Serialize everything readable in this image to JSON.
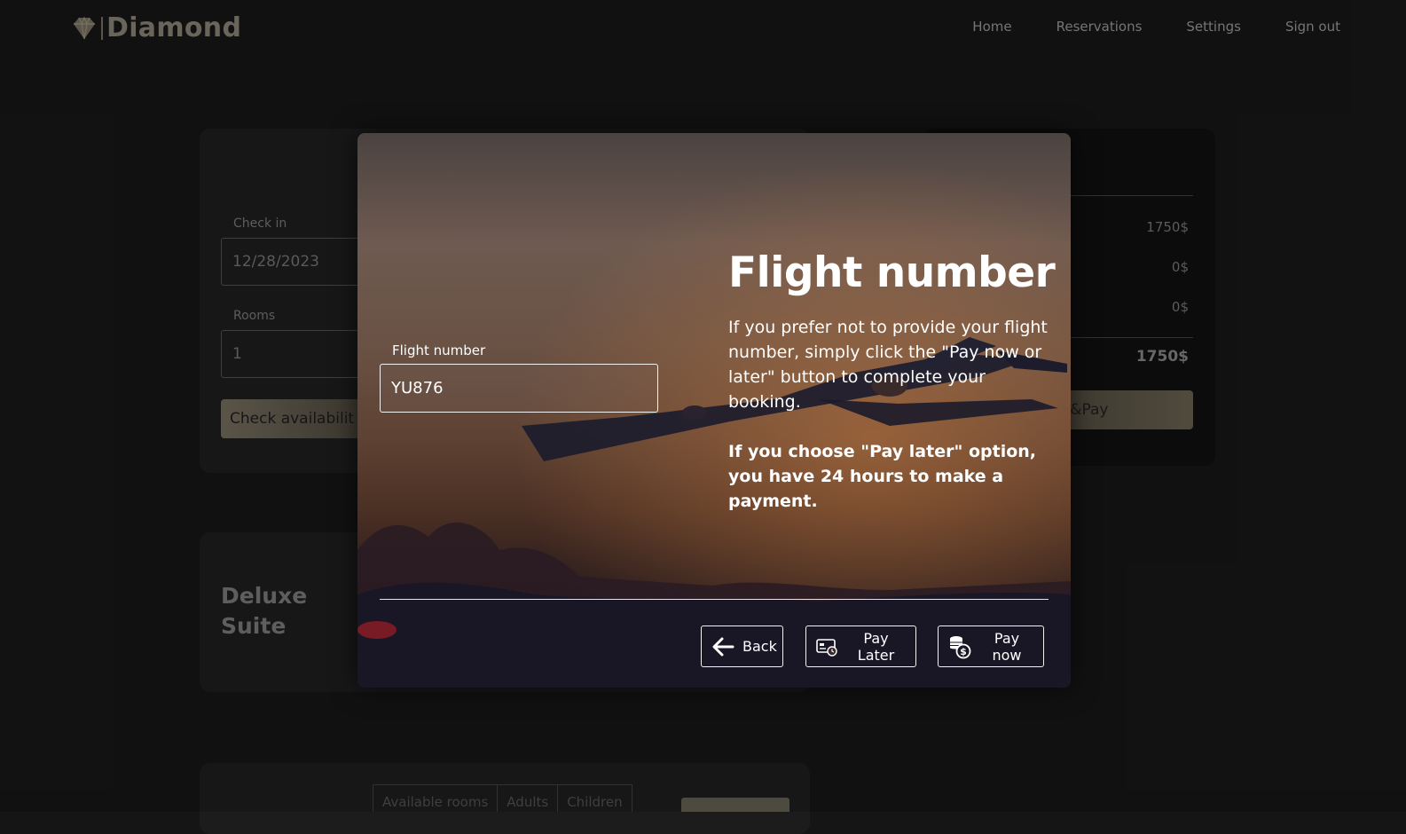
{
  "app": {
    "name": "Diamond"
  },
  "nav": {
    "items": [
      "Home",
      "Reservations",
      "Settings",
      "Sign out"
    ]
  },
  "booking": {
    "checkin_label": "Check in",
    "checkin_value": "12/28/2023",
    "rooms_label": "Rooms",
    "rooms_value": "1",
    "check_button": "Check availabilit"
  },
  "summary": {
    "values": [
      "1750$",
      "0$",
      "0$"
    ],
    "total": "1750$",
    "book_button": "ok&Pay"
  },
  "room": {
    "title": "Deluxe Suite",
    "tabs": [
      "Available rooms",
      "Adults",
      "Children"
    ]
  },
  "modal": {
    "field_label": "Flight number",
    "flight_value": "YU876",
    "title": "Flight number",
    "description": "If you prefer not to provide your flight number, simply click the \"Pay now or later\" button to complete your booking.",
    "note": "If you choose \"Pay later\" option, you have 24 hours to make a payment.",
    "back_label": "Back",
    "pay_later_label": "Pay Later",
    "pay_now_label": "Pay now"
  },
  "icons": [
    "diamond-logo-icon",
    "arrow-left-icon",
    "card-clock-icon",
    "coins-dollar-icon"
  ],
  "colors": {
    "brand": "#7d776c",
    "modal_text": "#ffffff",
    "background": "#151515"
  }
}
